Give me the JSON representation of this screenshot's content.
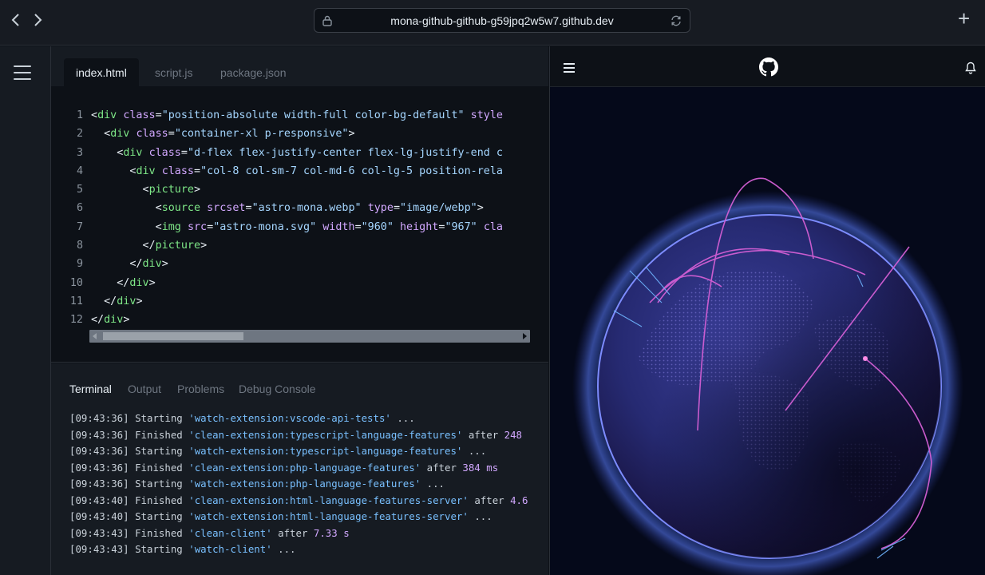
{
  "browser": {
    "back_icon": "chevron-left-icon",
    "forward_icon": "chevron-right-icon",
    "url": "mona-github-github-g59jpq2w5w7.github.dev",
    "new_tab_label": "+"
  },
  "editor": {
    "tabs": [
      {
        "label": "index.html"
      },
      {
        "label": "script.js"
      },
      {
        "label": "package.json"
      }
    ],
    "code_lines": [
      {
        "n": "1"
      },
      {
        "n": "2"
      },
      {
        "n": "3"
      },
      {
        "n": "4"
      },
      {
        "n": "5"
      },
      {
        "n": "6"
      },
      {
        "n": "7"
      },
      {
        "n": "8"
      },
      {
        "n": "9"
      },
      {
        "n": "10"
      },
      {
        "n": "11"
      },
      {
        "n": "12"
      }
    ]
  },
  "terminal": {
    "tabs": [
      {
        "label": "Terminal"
      },
      {
        "label": "Output"
      },
      {
        "label": "Problems"
      },
      {
        "label": "Debug Console"
      }
    ],
    "lines": [
      {
        "time": "[09:43:36]",
        "verb": "Starting",
        "task": "'watch-extension:vscode-api-tests'",
        "tail": " ...",
        "num": ""
      },
      {
        "time": "[09:43:36]",
        "verb": "Finished",
        "task": "'clean-extension:typescript-language-features'",
        "tail": " after ",
        "num": "248"
      },
      {
        "time": "[09:43:36]",
        "verb": "Starting",
        "task": "'watch-extension:typescript-language-features'",
        "tail": " ...",
        "num": ""
      },
      {
        "time": "[09:43:36]",
        "verb": "Finished",
        "task": "'clean-extension:php-language-features'",
        "tail": " after ",
        "num": "384 ms"
      },
      {
        "time": "[09:43:36]",
        "verb": "Starting",
        "task": "'watch-extension:php-language-features'",
        "tail": " ...",
        "num": ""
      },
      {
        "time": "[09:43:40]",
        "verb": "Finished",
        "task": "'clean-extension:html-language-features-server'",
        "tail": " after ",
        "num": "4.6"
      },
      {
        "time": "[09:43:40]",
        "verb": "Starting",
        "task": "'watch-extension:html-language-features-server'",
        "tail": " ...",
        "num": ""
      },
      {
        "time": "[09:43:43]",
        "verb": "Finished",
        "task": "'clean-client'",
        "tail": " after ",
        "num": "7.33 s"
      },
      {
        "time": "[09:43:43]",
        "verb": "Starting",
        "task": "'watch-client'",
        "tail": " ...",
        "num": ""
      }
    ]
  },
  "preview": {
    "menu_icon": "hamburger-icon",
    "logo_icon": "github-logo-icon",
    "bell_icon": "bell-icon"
  }
}
